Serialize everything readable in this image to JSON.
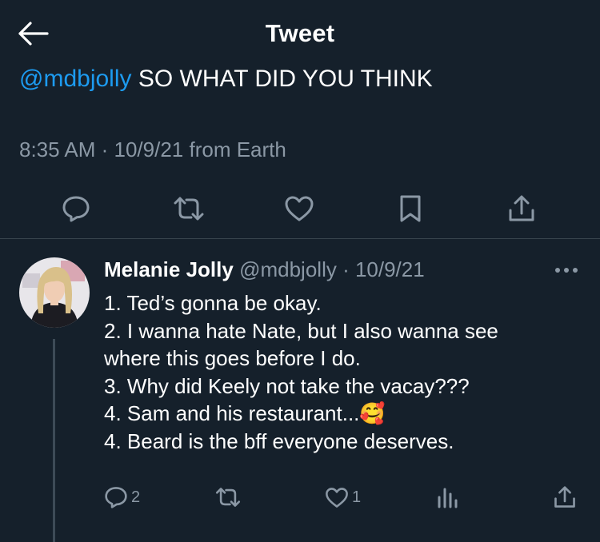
{
  "header": {
    "title": "Tweet",
    "back_icon": "arrow-left-icon"
  },
  "tweet": {
    "mention": "@mdbjolly",
    "text": " SO WHAT DID YOU THINK",
    "time": "8:35 AM",
    "sep": " · ",
    "date": "10/9/21",
    "source": " from Earth",
    "actions": [
      "reply-icon",
      "retweet-icon",
      "like-icon",
      "bookmark-icon",
      "share-icon"
    ]
  },
  "reply": {
    "name": "Melanie Jolly",
    "handle": "@mdbjolly",
    "sep": " · ",
    "date": "10/9/21",
    "lines": [
      "1. Ted’s gonna be okay.",
      "2. I wanna hate Nate, but I also wanna see",
      "where this goes before I do.",
      "3. Why did Keely not take the vacay???",
      "4. Sam and his restaurant...",
      "4. Beard is the bff everyone deserves."
    ],
    "emoji": "🥰",
    "counts": {
      "replies": "2",
      "likes": "1"
    }
  },
  "colors": {
    "background": "#15202b",
    "accent": "#1d9bf0",
    "secondary_text": "#8b98a5",
    "divider": "#38444d"
  }
}
